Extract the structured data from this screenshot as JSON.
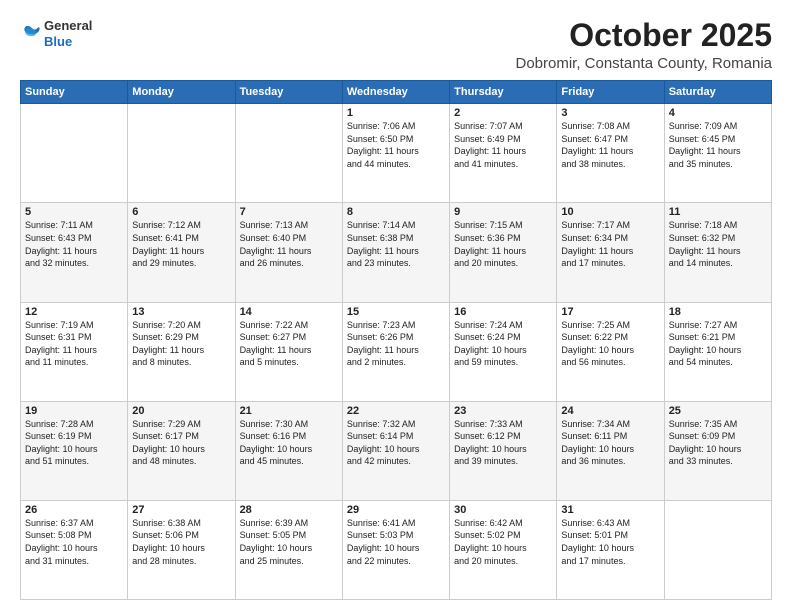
{
  "header": {
    "logo": {
      "line1": "General",
      "line2": "Blue"
    },
    "title": "October 2025",
    "subtitle": "Dobromir, Constanta County, Romania"
  },
  "days_of_week": [
    "Sunday",
    "Monday",
    "Tuesday",
    "Wednesday",
    "Thursday",
    "Friday",
    "Saturday"
  ],
  "weeks": [
    [
      {
        "day": "",
        "info": ""
      },
      {
        "day": "",
        "info": ""
      },
      {
        "day": "",
        "info": ""
      },
      {
        "day": "1",
        "info": "Sunrise: 7:06 AM\nSunset: 6:50 PM\nDaylight: 11 hours\nand 44 minutes."
      },
      {
        "day": "2",
        "info": "Sunrise: 7:07 AM\nSunset: 6:49 PM\nDaylight: 11 hours\nand 41 minutes."
      },
      {
        "day": "3",
        "info": "Sunrise: 7:08 AM\nSunset: 6:47 PM\nDaylight: 11 hours\nand 38 minutes."
      },
      {
        "day": "4",
        "info": "Sunrise: 7:09 AM\nSunset: 6:45 PM\nDaylight: 11 hours\nand 35 minutes."
      }
    ],
    [
      {
        "day": "5",
        "info": "Sunrise: 7:11 AM\nSunset: 6:43 PM\nDaylight: 11 hours\nand 32 minutes."
      },
      {
        "day": "6",
        "info": "Sunrise: 7:12 AM\nSunset: 6:41 PM\nDaylight: 11 hours\nand 29 minutes."
      },
      {
        "day": "7",
        "info": "Sunrise: 7:13 AM\nSunset: 6:40 PM\nDaylight: 11 hours\nand 26 minutes."
      },
      {
        "day": "8",
        "info": "Sunrise: 7:14 AM\nSunset: 6:38 PM\nDaylight: 11 hours\nand 23 minutes."
      },
      {
        "day": "9",
        "info": "Sunrise: 7:15 AM\nSunset: 6:36 PM\nDaylight: 11 hours\nand 20 minutes."
      },
      {
        "day": "10",
        "info": "Sunrise: 7:17 AM\nSunset: 6:34 PM\nDaylight: 11 hours\nand 17 minutes."
      },
      {
        "day": "11",
        "info": "Sunrise: 7:18 AM\nSunset: 6:32 PM\nDaylight: 11 hours\nand 14 minutes."
      }
    ],
    [
      {
        "day": "12",
        "info": "Sunrise: 7:19 AM\nSunset: 6:31 PM\nDaylight: 11 hours\nand 11 minutes."
      },
      {
        "day": "13",
        "info": "Sunrise: 7:20 AM\nSunset: 6:29 PM\nDaylight: 11 hours\nand 8 minutes."
      },
      {
        "day": "14",
        "info": "Sunrise: 7:22 AM\nSunset: 6:27 PM\nDaylight: 11 hours\nand 5 minutes."
      },
      {
        "day": "15",
        "info": "Sunrise: 7:23 AM\nSunset: 6:26 PM\nDaylight: 11 hours\nand 2 minutes."
      },
      {
        "day": "16",
        "info": "Sunrise: 7:24 AM\nSunset: 6:24 PM\nDaylight: 10 hours\nand 59 minutes."
      },
      {
        "day": "17",
        "info": "Sunrise: 7:25 AM\nSunset: 6:22 PM\nDaylight: 10 hours\nand 56 minutes."
      },
      {
        "day": "18",
        "info": "Sunrise: 7:27 AM\nSunset: 6:21 PM\nDaylight: 10 hours\nand 54 minutes."
      }
    ],
    [
      {
        "day": "19",
        "info": "Sunrise: 7:28 AM\nSunset: 6:19 PM\nDaylight: 10 hours\nand 51 minutes."
      },
      {
        "day": "20",
        "info": "Sunrise: 7:29 AM\nSunset: 6:17 PM\nDaylight: 10 hours\nand 48 minutes."
      },
      {
        "day": "21",
        "info": "Sunrise: 7:30 AM\nSunset: 6:16 PM\nDaylight: 10 hours\nand 45 minutes."
      },
      {
        "day": "22",
        "info": "Sunrise: 7:32 AM\nSunset: 6:14 PM\nDaylight: 10 hours\nand 42 minutes."
      },
      {
        "day": "23",
        "info": "Sunrise: 7:33 AM\nSunset: 6:12 PM\nDaylight: 10 hours\nand 39 minutes."
      },
      {
        "day": "24",
        "info": "Sunrise: 7:34 AM\nSunset: 6:11 PM\nDaylight: 10 hours\nand 36 minutes."
      },
      {
        "day": "25",
        "info": "Sunrise: 7:35 AM\nSunset: 6:09 PM\nDaylight: 10 hours\nand 33 minutes."
      }
    ],
    [
      {
        "day": "26",
        "info": "Sunrise: 6:37 AM\nSunset: 5:08 PM\nDaylight: 10 hours\nand 31 minutes."
      },
      {
        "day": "27",
        "info": "Sunrise: 6:38 AM\nSunset: 5:06 PM\nDaylight: 10 hours\nand 28 minutes."
      },
      {
        "day": "28",
        "info": "Sunrise: 6:39 AM\nSunset: 5:05 PM\nDaylight: 10 hours\nand 25 minutes."
      },
      {
        "day": "29",
        "info": "Sunrise: 6:41 AM\nSunset: 5:03 PM\nDaylight: 10 hours\nand 22 minutes."
      },
      {
        "day": "30",
        "info": "Sunrise: 6:42 AM\nSunset: 5:02 PM\nDaylight: 10 hours\nand 20 minutes."
      },
      {
        "day": "31",
        "info": "Sunrise: 6:43 AM\nSunset: 5:01 PM\nDaylight: 10 hours\nand 17 minutes."
      },
      {
        "day": "",
        "info": ""
      }
    ]
  ]
}
